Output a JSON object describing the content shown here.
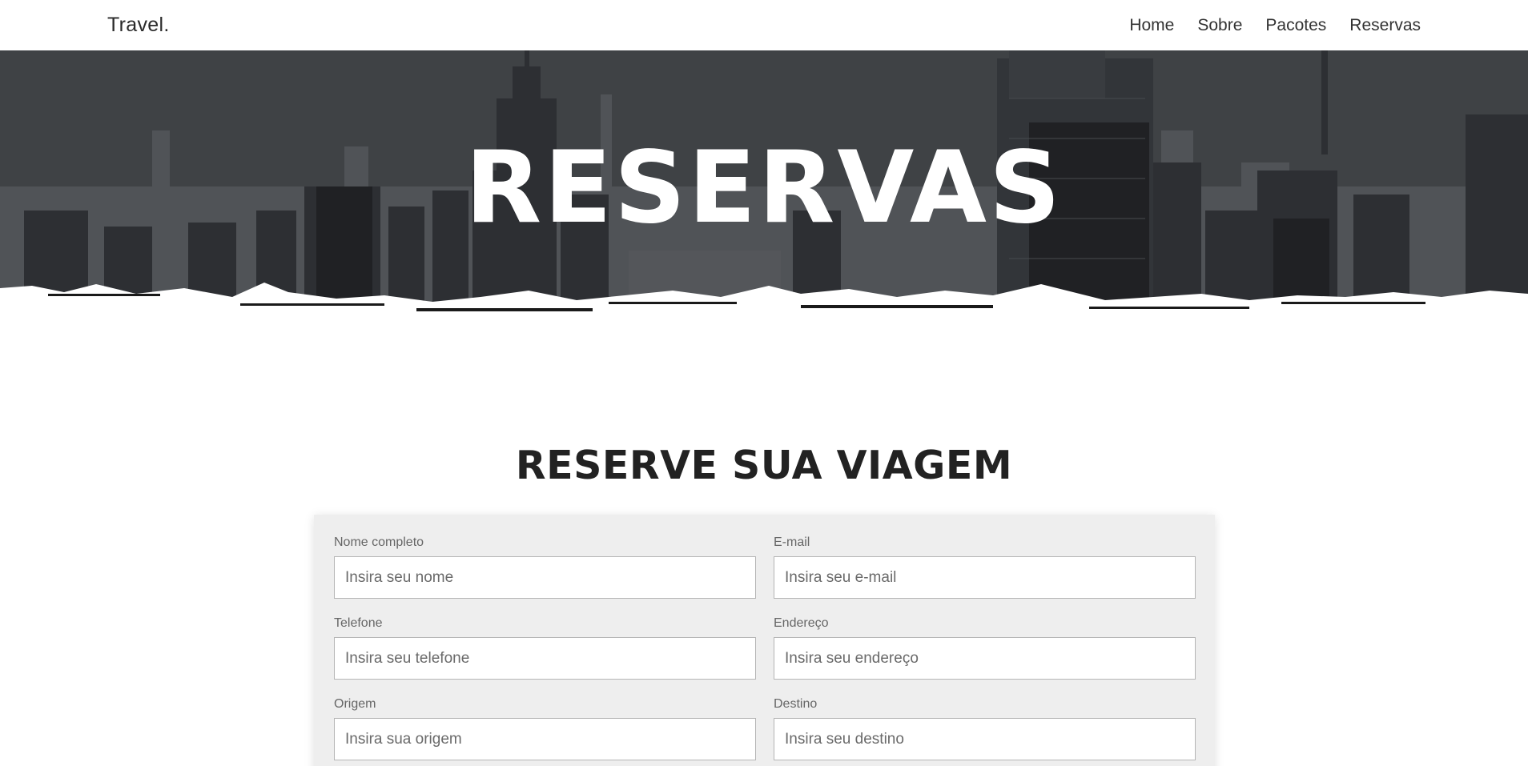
{
  "navbar": {
    "brand": "Travel.",
    "links": [
      {
        "label": "Home"
      },
      {
        "label": "Sobre"
      },
      {
        "label": "Pacotes"
      },
      {
        "label": "Reservas"
      }
    ]
  },
  "hero": {
    "title": "RESERVAS"
  },
  "booking": {
    "title": "RESERVE SUA VIAGEM",
    "fields": [
      {
        "label": "Nome completo",
        "placeholder": "Insira seu nome",
        "value": ""
      },
      {
        "label": "E-mail",
        "placeholder": "Insira seu e-mail",
        "value": ""
      },
      {
        "label": "Telefone",
        "placeholder": "Insira seu telefone",
        "value": ""
      },
      {
        "label": "Endereço",
        "placeholder": "Insira seu endereço",
        "value": ""
      },
      {
        "label": "Origem",
        "placeholder": "Insira sua origem",
        "value": ""
      },
      {
        "label": "Destino",
        "placeholder": "Insira seu destino",
        "value": ""
      }
    ]
  },
  "colors": {
    "text_dark": "#222222",
    "form_background": "#eeeeee",
    "hero_overlay": "#4b4f55"
  }
}
